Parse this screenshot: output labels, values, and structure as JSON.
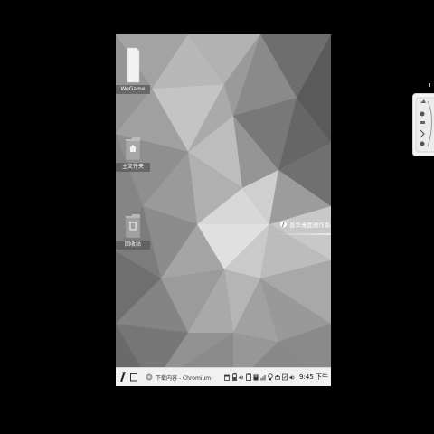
{
  "desktop": {
    "icons": [
      {
        "label": "WeGame",
        "icon": "wegame-file-icon"
      },
      {
        "label": "主文件夹",
        "icon": "home-folder-icon"
      },
      {
        "label": "回收站",
        "icon": "trash-icon"
      }
    ],
    "brand_text": "普华桌面操作系统"
  },
  "taskbar": {
    "task_label": "下载内容 - Chromium",
    "clock": "9:45 下午"
  },
  "colors": {
    "taskbar_bg": "#f1f1f1",
    "wallpaper_base": "#8f8f8f",
    "background": "#000000"
  }
}
